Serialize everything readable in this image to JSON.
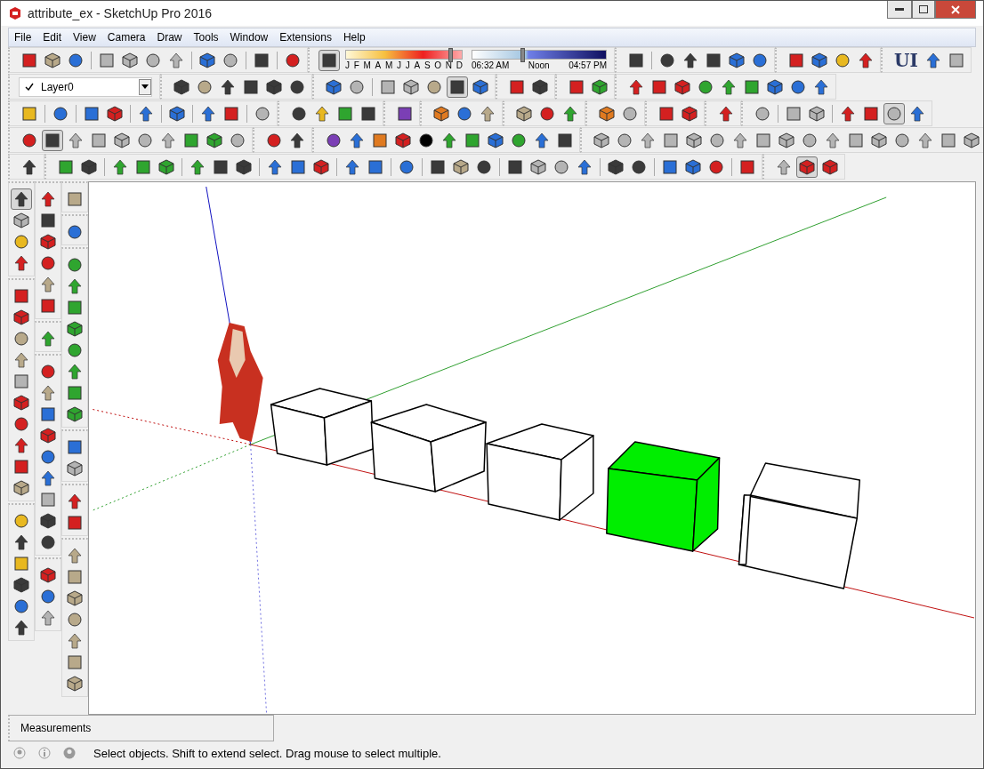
{
  "window": {
    "title": "attribute_ex - SketchUp Pro 2016"
  },
  "menu": [
    "File",
    "Edit",
    "View",
    "Camera",
    "Draw",
    "Tools",
    "Window",
    "Extensions",
    "Help"
  ],
  "toggles": {
    "shadows": {
      "on": true
    },
    "face_style": {
      "on": true
    },
    "soften": {
      "on": true
    },
    "camera_record": {
      "on": true
    },
    "section": {
      "on": true
    },
    "select_tool": {
      "on": true
    }
  },
  "shadow_panel": {
    "months": [
      "J",
      "F",
      "M",
      "A",
      "M",
      "J",
      "J",
      "A",
      "S",
      "O",
      "N",
      "D"
    ],
    "month_slider": {
      "level": 0.91
    },
    "times": [
      "06:32 AM",
      "Noon",
      "04:57 PM"
    ],
    "time_slider": {
      "level": 0.37
    }
  },
  "layer": {
    "value": "Layer0"
  },
  "text_tools": [
    "UI"
  ],
  "scene": {
    "boxes": [
      {
        "color": "#ffffff"
      },
      {
        "color": "#ffffff"
      },
      {
        "color": "#ffffff"
      },
      {
        "color": "#00ee00"
      },
      {
        "color": "#ffffff"
      }
    ]
  },
  "measurements": {
    "label": "Measurements"
  },
  "status_bar": {
    "message": "Select objects. Shift to extend select. Drag mouse to select multiple."
  }
}
